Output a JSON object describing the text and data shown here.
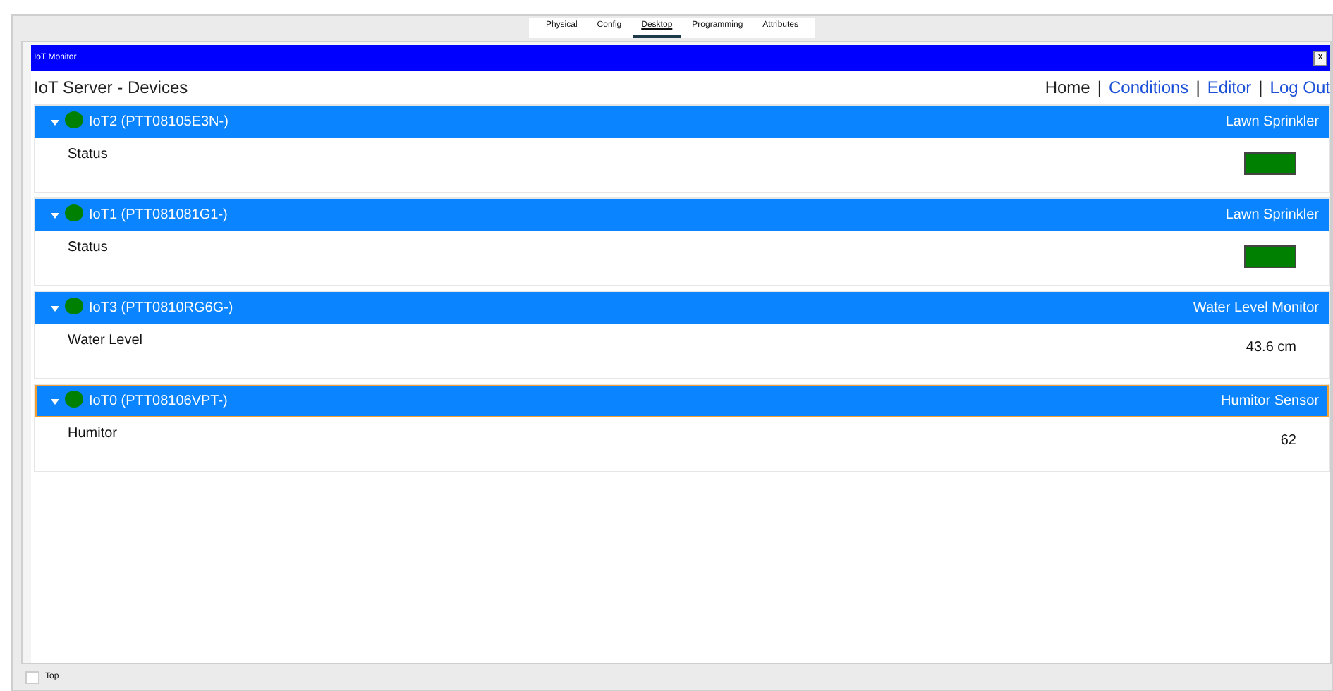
{
  "tabs": [
    {
      "label": "Physical",
      "selected": false
    },
    {
      "label": "Config",
      "selected": false
    },
    {
      "label": "Desktop",
      "selected": true
    },
    {
      "label": "Programming",
      "selected": false
    },
    {
      "label": "Attributes",
      "selected": false
    }
  ],
  "window": {
    "title": "IoT Monitor",
    "close": "x"
  },
  "page": {
    "title": "IoT Server - Devices",
    "separator": "|",
    "nav": [
      {
        "label": "Home",
        "kind": "current"
      },
      {
        "label": "Conditions",
        "kind": "link"
      },
      {
        "label": "Editor",
        "kind": "link"
      },
      {
        "label": "Log Out",
        "kind": "link"
      }
    ]
  },
  "devices": [
    {
      "name": "IoT2 (PTT08105E3N-)",
      "type": "Lawn Sprinkler",
      "expanded": true,
      "selected": false,
      "color": "#008000",
      "rows": [
        {
          "label": "Status",
          "kind": "indicator",
          "color": "#008000"
        }
      ]
    },
    {
      "name": "IoT1 (PTT081081G1-)",
      "type": "Lawn Sprinkler",
      "expanded": true,
      "selected": false,
      "color": "#008000",
      "rows": [
        {
          "label": "Status",
          "kind": "indicator",
          "color": "#008000"
        }
      ]
    },
    {
      "name": "IoT3 (PTT0810RG6G-)",
      "type": "Water Level Monitor",
      "expanded": true,
      "selected": false,
      "color": "#008000",
      "rows": [
        {
          "label": "Water Level",
          "kind": "value",
          "value": "43.6 cm"
        }
      ]
    },
    {
      "name": "IoT0 (PTT08106VPT-)",
      "type": "Humitor Sensor",
      "expanded": true,
      "selected": true,
      "color": "#008000",
      "rows": [
        {
          "label": "Humitor",
          "kind": "value",
          "value": "62"
        }
      ]
    }
  ],
  "footer": {
    "label": "Top",
    "checked": false
  }
}
